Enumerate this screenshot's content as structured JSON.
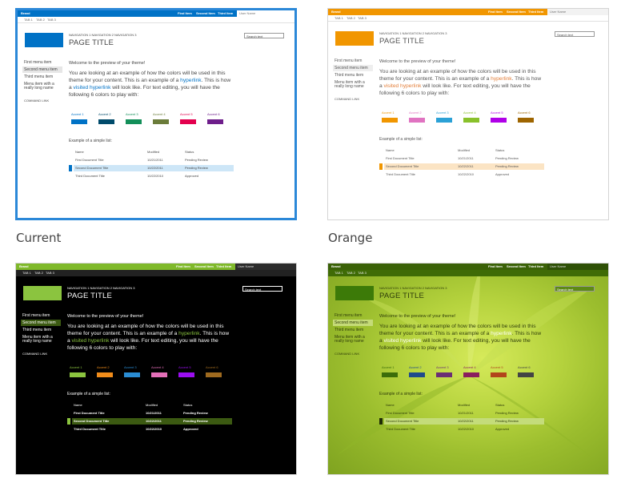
{
  "themes": [
    {
      "caption": "Current",
      "selected": true,
      "colors": {
        "bg": "#ffffff",
        "topbar": "#ffffff",
        "suitebar": "#0072c6",
        "accent_block": "#0072c6",
        "text": "#444444",
        "link": "#0072c6",
        "visited": "#0072c6",
        "hl_row": "#cde6f7",
        "hl_mark": "#0072c6",
        "search_bg": "#ffffff",
        "search_text": "#444444",
        "side_sel": "#e6e6e6"
      },
      "suite": {
        "brand": "Brand",
        "items": [
          "Find Item",
          "Second Item",
          "Third Item"
        ],
        "user": "User Name"
      },
      "tabs": [
        "TAB 1",
        "TAB 2",
        "TAB 3"
      ],
      "breadcrumb": "NAVIGATION 1  NAVIGATION 2  NAVIGATION 3",
      "page_title": "PAGE TITLE",
      "search_placeholder": "Search text",
      "side_menu": [
        "First menu item",
        "Second menu item",
        "Third menu item",
        "Menu item with a really long name"
      ],
      "command_link": "COMMAND LINK",
      "welcome": "Welcome to the preview of your theme!",
      "body_pre": "You are looking at an example of how the colors will be used in this theme for your content. This is an example of a",
      "hyperlink": "hyperlink",
      "body_mid": ". This is how a",
      "visited": "visited hyperlink",
      "body_post": "will look like. For text editing, you will have the following 6 colors to play with:",
      "accents": [
        {
          "label": "Accent 1",
          "color": "#0072c6"
        },
        {
          "label": "Accent 2",
          "color": "#004b6b"
        },
        {
          "label": "Accent 3",
          "color": "#138f59"
        },
        {
          "label": "Accent 4",
          "color": "#6b7c3a"
        },
        {
          "label": "Accent 5",
          "color": "#e3004e"
        },
        {
          "label": "Accent 6",
          "color": "#6e1e8b"
        }
      ],
      "list_title": "Example of a simple list:",
      "list_headers": [
        "Name",
        "Modified",
        "Status"
      ],
      "list_rows": [
        [
          "First Document Title",
          "10/21/2011",
          "Pending Review"
        ],
        [
          "Second Document Title",
          "10/22/2011",
          "Pending Review"
        ],
        [
          "Third Document Title",
          "10/22/2010",
          "Approved"
        ]
      ]
    },
    {
      "caption": "Orange",
      "selected": false,
      "colors": {
        "bg": "#ffffff",
        "topbar": "#ffffff",
        "suitebar": "#f19600",
        "accent_block": "#f19600",
        "text": "#555555",
        "link": "#e37f3a",
        "visited": "#e37f3a",
        "hl_row": "#fbe4c4",
        "hl_mark": "#f19600",
        "search_bg": "#ffffff",
        "search_text": "#555555",
        "side_sel": "#eeeeee"
      },
      "suite": {
        "brand": "Brand",
        "items": [
          "Find Item",
          "Second Item",
          "Third Item"
        ],
        "user": "User Name"
      },
      "tabs": [
        "TAB 1",
        "TAB 2",
        "TAB 3"
      ],
      "breadcrumb": "NAVIGATION 1  NAVIGATION 2  NAVIGATION 3",
      "page_title": "PAGE TITLE",
      "search_placeholder": "Search text",
      "side_menu": [
        "First menu item",
        "Second menu item",
        "Third menu item",
        "Menu item with a really long name"
      ],
      "command_link": "COMMAND LINK",
      "welcome": "Welcome to the preview of your theme!",
      "body_pre": "You are looking at an example of how the colors will be used in this theme for your content. This is an example of a",
      "hyperlink": "hyperlink",
      "body_mid": ". This is how a",
      "visited": "visited hyperlink",
      "body_post": "will look like. For text editing, you will have the following 6 colors to play with:",
      "accents": [
        {
          "label": "Accent 1",
          "color": "#f19600"
        },
        {
          "label": "Accent 2",
          "color": "#e073c1"
        },
        {
          "label": "Accent 3",
          "color": "#2ba1d6"
        },
        {
          "label": "Accent 4",
          "color": "#89c12b"
        },
        {
          "label": "Accent 5",
          "color": "#b000e8"
        },
        {
          "label": "Accent 6",
          "color": "#9e6500"
        }
      ],
      "list_title": "Example of a simple list:",
      "list_headers": [
        "Name",
        "Modified",
        "Status"
      ],
      "list_rows": [
        [
          "First Document Title",
          "10/21/2011",
          "Pending Review"
        ],
        [
          "Second Document Title",
          "10/22/2011",
          "Pending Review"
        ],
        [
          "Third Document Title",
          "10/22/2010",
          "Approved"
        ]
      ]
    },
    {
      "caption": "",
      "selected": false,
      "colors": {
        "bg": "#000000",
        "topbar": "#222222",
        "suitebar": "#7fb92a",
        "accent_block": "#8bc43f",
        "text": "#ffffff",
        "link": "#8bc43f",
        "visited": "#8bc43f",
        "hl_row": "#3c5a12",
        "hl_mark": "#8bc43f",
        "search_bg": "#000000",
        "search_text": "#ffffff",
        "side_sel": "#3c5a12"
      },
      "suite": {
        "brand": "Brand",
        "items": [
          "Find Item",
          "Second Item",
          "Third Item"
        ],
        "user": "User Name"
      },
      "tabs": [
        "TAB 1",
        "TAB 2",
        "TAB 3"
      ],
      "breadcrumb": "NAVIGATION 1  NAVIGATION 2  NAVIGATION 3",
      "page_title": "PAGE TITLE",
      "search_placeholder": "Search text",
      "side_menu": [
        "First menu item",
        "Second menu item",
        "Third menu item",
        "Menu item with a really long name"
      ],
      "command_link": "COMMAND LINK",
      "welcome": "Welcome to the preview of your theme!",
      "body_pre": "You are looking at an example of how the colors will be used in this theme for your content. This is an example of a",
      "hyperlink": "hyperlink",
      "body_mid": ". This is how a",
      "visited": "visited hyperlink",
      "body_post": "will look like. For text editing, you will have the following 6 colors to play with:",
      "accents": [
        {
          "label": "Accent 1",
          "color": "#8bc43f"
        },
        {
          "label": "Accent 2",
          "color": "#f08c1a"
        },
        {
          "label": "Accent 3",
          "color": "#2a8dd4"
        },
        {
          "label": "Accent 4",
          "color": "#e46fb8"
        },
        {
          "label": "Accent 5",
          "color": "#9b0ef0"
        },
        {
          "label": "Accent 6",
          "color": "#9e6a1f"
        }
      ],
      "list_title": "Example of a simple list:",
      "list_headers": [
        "Name",
        "Modified",
        "Status"
      ],
      "list_rows": [
        [
          "First Document Title",
          "10/21/2011",
          "Pending Review"
        ],
        [
          "Second Document Title",
          "10/22/2011",
          "Pending Review"
        ],
        [
          "Third Document Title",
          "10/22/2010",
          "Approved"
        ]
      ]
    },
    {
      "caption": "",
      "selected": false,
      "colors": {
        "bg": "#a9c83a",
        "topbar": "#3f6b06",
        "suitebar": "#3a6107",
        "accent_block": "#3c7a08",
        "text": "#2f3d0a",
        "link": "#ffffff",
        "visited": "#ffffff",
        "hl_row": "#c4dc7a",
        "hl_mark": "#1e2b05",
        "search_bg": "#5d8a14",
        "search_text": "#ffffff",
        "side_sel": "#c5db78"
      },
      "suite": {
        "brand": "Brand",
        "items": [
          "Find Item",
          "Second Item",
          "Third Item"
        ],
        "user": "User Name"
      },
      "tabs": [
        "TAB 1",
        "TAB 2",
        "TAB 3"
      ],
      "breadcrumb": "NAVIGATION 1  NAVIGATION 2  NAVIGATION 3",
      "page_title": "PAGE TITLE",
      "search_placeholder": "Search text",
      "side_menu": [
        "First menu item",
        "Second menu item",
        "Third menu item",
        "Menu item with a really long name"
      ],
      "command_link": "COMMAND LINK",
      "welcome": "Welcome to the preview of your theme!",
      "body_pre": "You are looking at an example of how the colors will be used in this theme for your content. This is an example of a",
      "hyperlink": "hyperlink",
      "body_mid": ". This is how a",
      "visited": "visited hyperlink",
      "body_post": "will look like. For text editing, you will have the following 6 colors to play with:",
      "accents": [
        {
          "label": "Accent 1",
          "color": "#3b6d0a"
        },
        {
          "label": "Accent 2",
          "color": "#1f4b8c"
        },
        {
          "label": "Accent 3",
          "color": "#6b2f74"
        },
        {
          "label": "Accent 4",
          "color": "#8a1f5e"
        },
        {
          "label": "Accent 5",
          "color": "#b2461b"
        },
        {
          "label": "Accent 6",
          "color": "#444444"
        }
      ],
      "list_title": "Example of a simple list:",
      "list_headers": [
        "Name",
        "Modified",
        "Status"
      ],
      "list_rows": [
        [
          "First Document Title",
          "10/21/2011",
          "Pending Review"
        ],
        [
          "Second Document Title",
          "10/22/2011",
          "Pending Review"
        ],
        [
          "Third Document Title",
          "10/22/2010",
          "Approved"
        ]
      ]
    }
  ]
}
